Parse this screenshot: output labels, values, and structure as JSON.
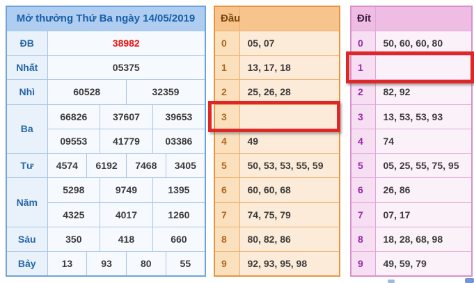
{
  "theme": {
    "blue_border": "#6FA3DC",
    "blue_header_bg": "#AECDF0",
    "blue_text": "#2567A8",
    "orange_border": "#E8953F",
    "orange_header_bg": "#F7C48D",
    "orange_key_text": "#B3641B",
    "pink_border": "#DA8FCC",
    "pink_header_bg": "#EFBCE3",
    "purple_key_text": "#9B27A8",
    "special_prize_red": "#EE1111",
    "highlight_red": "#DE2727",
    "value_text": "#3A3A3A"
  },
  "left_table": {
    "title": "Mở thưởng Thứ Ba ngày 14/05/2019",
    "rows": [
      {
        "label": "ĐB",
        "cells": [
          "38982"
        ]
      },
      {
        "label": "Nhất",
        "cells": [
          "05375"
        ]
      },
      {
        "label": "Nhì",
        "cells": [
          "60528",
          "32359"
        ]
      },
      {
        "label": "Ba",
        "cells": [
          "66826",
          "37607",
          "39653"
        ],
        "cells2": [
          "09553",
          "41779",
          "03386"
        ]
      },
      {
        "label": "Tư",
        "cells": [
          "4574",
          "6192",
          "7468",
          "3405"
        ]
      },
      {
        "label": "Năm",
        "cells": [
          "5298",
          "9749",
          "1395"
        ],
        "cells2": [
          "4325",
          "4017",
          "1260"
        ]
      },
      {
        "label": "Sáu",
        "cells": [
          "350",
          "418",
          "660"
        ]
      },
      {
        "label": "Bảy",
        "cells": [
          "13",
          "93",
          "80",
          "55"
        ]
      }
    ]
  },
  "dau": {
    "header": "Đầu",
    "rows": [
      {
        "key": "0",
        "value": "05, 07"
      },
      {
        "key": "1",
        "value": "13, 17, 18"
      },
      {
        "key": "2",
        "value": "25, 26, 28"
      },
      {
        "key": "3",
        "value": ""
      },
      {
        "key": "4",
        "value": "49"
      },
      {
        "key": "5",
        "value": "50, 53, 53, 55, 59"
      },
      {
        "key": "6",
        "value": "60, 60, 68"
      },
      {
        "key": "7",
        "value": "74, 75, 79"
      },
      {
        "key": "8",
        "value": "80, 82, 86"
      },
      {
        "key": "9",
        "value": "92, 93, 95, 98"
      }
    ]
  },
  "dit": {
    "header": "Đít",
    "rows": [
      {
        "key": "0",
        "value": "50, 60, 60, 80"
      },
      {
        "key": "1",
        "value": ""
      },
      {
        "key": "2",
        "value": "82, 92"
      },
      {
        "key": "3",
        "value": "13, 53, 53, 93"
      },
      {
        "key": "4",
        "value": "74"
      },
      {
        "key": "5",
        "value": "05, 25, 55, 75, 95"
      },
      {
        "key": "6",
        "value": "26, 86"
      },
      {
        "key": "7",
        "value": "07, 17"
      },
      {
        "key": "8",
        "value": "18, 28, 68, 98"
      },
      {
        "key": "9",
        "value": "49, 59, 79"
      }
    ]
  },
  "highlights": [
    {
      "table": "dau",
      "row": "3"
    },
    {
      "table": "dit",
      "row": "1"
    }
  ]
}
